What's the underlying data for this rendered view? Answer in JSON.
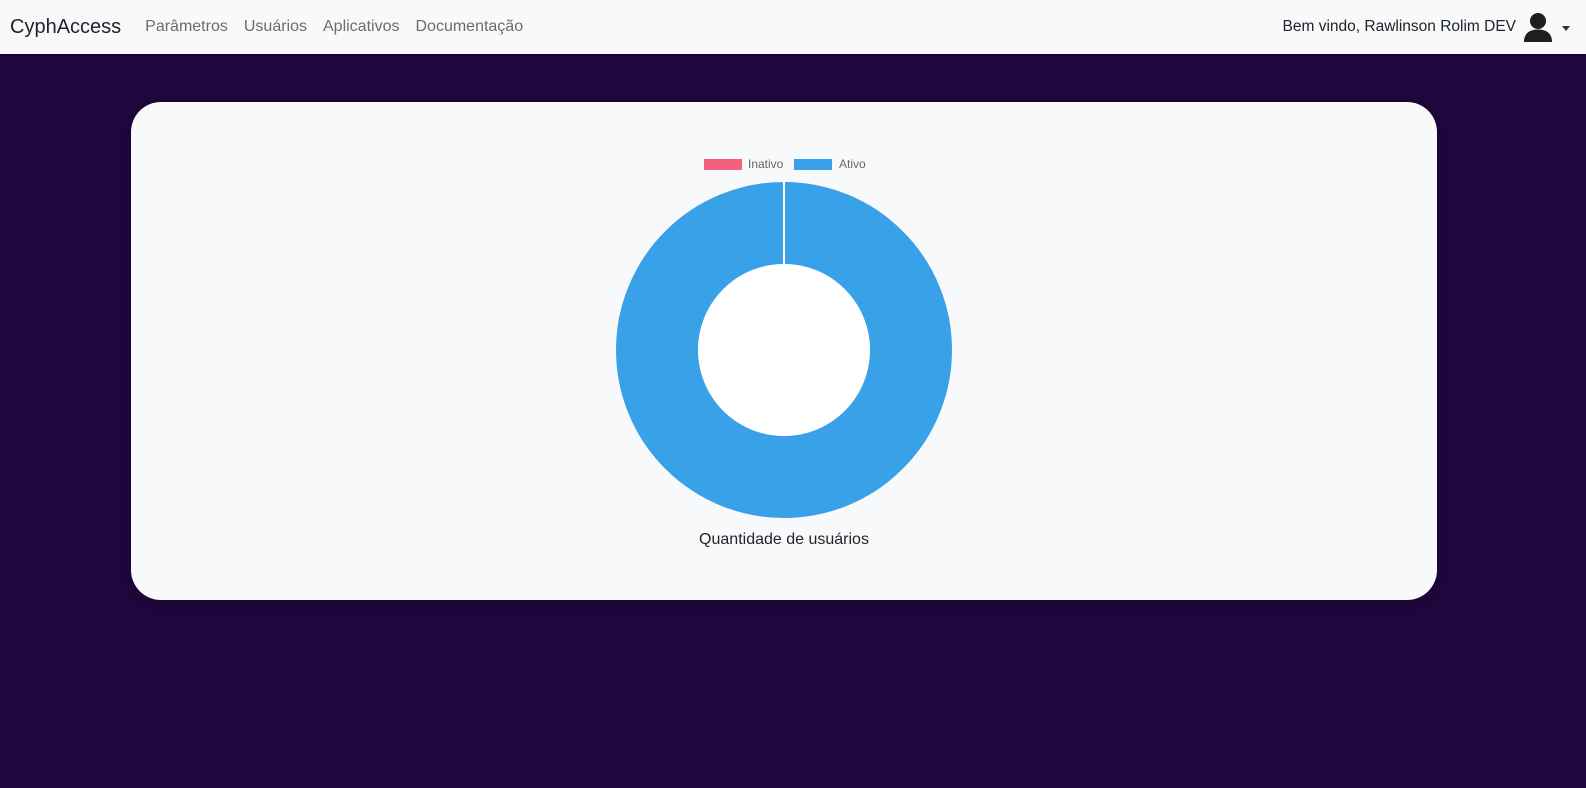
{
  "navbar": {
    "brand": "CyphAccess",
    "links": [
      "Parâmetros",
      "Usuários",
      "Aplicativos",
      "Documentação"
    ],
    "welcome": "Bem vindo, Rawlinson Rolim DEV",
    "user_icon": "user-icon",
    "dropdown_icon": "caret-down-icon"
  },
  "card": {
    "caption": "Quantidade de usuários"
  },
  "chart_data": {
    "type": "pie",
    "variant": "doughnut",
    "categories": [
      "Inativo",
      "Ativo"
    ],
    "values": [
      0,
      1
    ],
    "colors": [
      "#f3617f",
      "#38a1e8"
    ],
    "legend_position": "top",
    "title": ""
  }
}
